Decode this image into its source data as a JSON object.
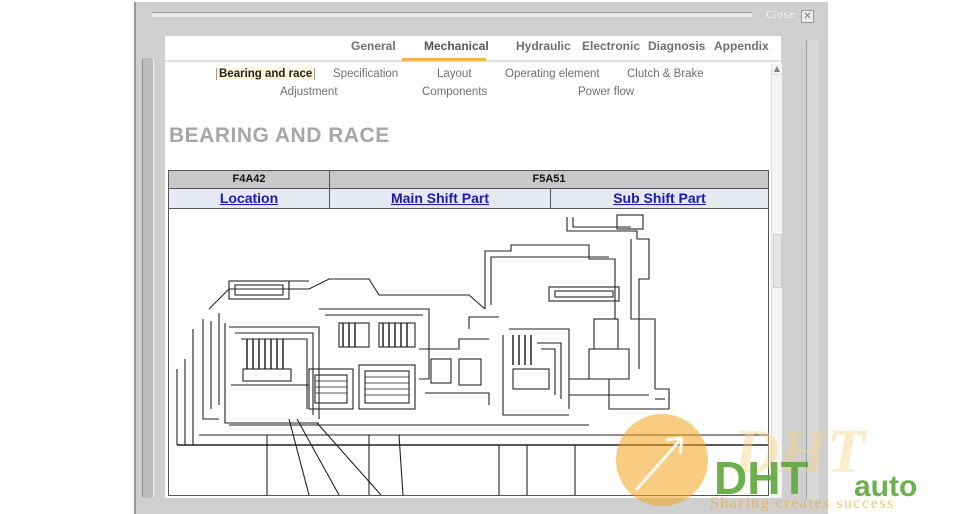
{
  "window": {
    "close_label": "Close",
    "close_glyph": "✕"
  },
  "tabs": [
    {
      "label": "General",
      "active": false
    },
    {
      "label": "Mechanical",
      "active": true
    },
    {
      "label": "Hydraulic",
      "active": false
    },
    {
      "label": "Electronic",
      "active": false
    },
    {
      "label": "Diagnosis",
      "active": false
    },
    {
      "label": "Appendix",
      "active": false
    }
  ],
  "subnav": [
    {
      "label": "Bearing and race",
      "current": true
    },
    {
      "label": "Specification",
      "current": false
    },
    {
      "label": "Layout",
      "current": false
    },
    {
      "label": "Operating element",
      "current": false
    },
    {
      "label": "Clutch & Brake",
      "current": false
    },
    {
      "label": "Adjustment",
      "current": false
    },
    {
      "label": "Components",
      "current": false
    },
    {
      "label": "Power flow",
      "current": false
    }
  ],
  "page": {
    "title": "BEARING AND RACE"
  },
  "table": {
    "headers": [
      "F4A42",
      "F5A51"
    ],
    "links": [
      "Location",
      "Main Shift Part",
      "Sub Shift Part"
    ]
  },
  "scrollbar": {
    "up_glyph": "▲"
  },
  "watermark": {
    "brand": "DHT",
    "brand2": "auto",
    "tagline": "Sharing creates success"
  },
  "colors": {
    "tab_accent": "#f2b14a",
    "link": "#1a1ab0",
    "title_gray": "#a7a7a7",
    "watermark_orange": "#f2a21c",
    "watermark_green": "#5ea83a"
  }
}
